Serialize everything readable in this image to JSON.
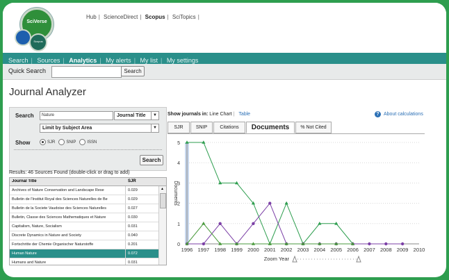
{
  "header": {
    "logo_main": "SciVerse",
    "logo_sub": "Scopus",
    "links": [
      "Hub",
      "ScienceDirect",
      "Scopus",
      "SciTopics"
    ],
    "active_link": "Scopus"
  },
  "nav": {
    "items": [
      "Search",
      "Sources",
      "Analytics",
      "My alerts",
      "My list",
      "My settings"
    ],
    "active": "Analytics"
  },
  "quick_search": {
    "label": "Quick Search",
    "value": "",
    "button": "Search"
  },
  "page_title": "Journal Analyzer",
  "search_panel": {
    "search_label": "Search",
    "search_value": "Nature",
    "search_type": "Journal Title",
    "filter": "Limit by Subject Area",
    "show_label": "Show",
    "metrics": [
      "SJR",
      "SNIP",
      "ISSN"
    ],
    "selected_metric": "SJR",
    "search_button": "Search"
  },
  "results": {
    "summary": "Results: 46 Sources Found (double-click or drag to add)",
    "columns": [
      "Journal Title",
      "SJR"
    ],
    "rows": [
      {
        "title": "Archives of Nature Conservation and Landscape Rese",
        "sjr": "0.029"
      },
      {
        "title": "Bulletin de l'Institut Royal des Sciences Naturelles de Be",
        "sjr": "0.029"
      },
      {
        "title": "Bulletin de la Societe Vaudoise des Sciences Naturelles",
        "sjr": "0.027"
      },
      {
        "title": "Bulletin, Classe des Sciences Mathematiques et Nature",
        "sjr": "0.030"
      },
      {
        "title": "Capitalism, Nature, Socialism",
        "sjr": "0.031"
      },
      {
        "title": "Discrete Dynamics in Nature and Society",
        "sjr": "0.040"
      },
      {
        "title": "Fortschritte der Chemie Organischer Naturstoffe",
        "sjr": "0.201"
      },
      {
        "title": "Human Nature",
        "sjr": "0.072"
      },
      {
        "title": "Humans and Nature",
        "sjr": "0.031"
      }
    ],
    "selected_row": 7
  },
  "chart_panel": {
    "show_journals_label": "Show journals in:",
    "view_line": "Line Chart",
    "view_table": "Table",
    "about": "About calculations",
    "tabs": [
      "SJR",
      "SNIP",
      "Citations",
      "Documents",
      "% Not Cited"
    ],
    "active_tab": "Documents"
  },
  "chart_data": {
    "type": "line",
    "ylabel": "Documents",
    "xlabel": "Zoom Year",
    "x": [
      1996,
      1997,
      1998,
      1999,
      2000,
      2001,
      2002,
      2003,
      2004,
      2005,
      2006,
      2007,
      2008,
      2009,
      2010
    ],
    "ylim": [
      0,
      5
    ],
    "yticks": [
      0,
      1,
      2,
      3,
      4,
      5
    ],
    "series": [
      {
        "color": "#2e9e4f",
        "marker": "triangle",
        "values": [
          5,
          5,
          3,
          3,
          2,
          0,
          2,
          0,
          1,
          1,
          0,
          null,
          null,
          null,
          null
        ]
      },
      {
        "color": "#7b3fa6",
        "marker": "circle",
        "values": [
          0,
          0,
          1,
          0,
          1,
          2,
          0,
          0,
          0,
          0,
          0,
          0,
          0,
          0,
          null
        ]
      },
      {
        "color": "#4a9a3c",
        "marker": "triangle",
        "values": [
          0,
          1,
          0,
          0,
          0,
          0,
          0,
          0,
          0,
          0,
          0,
          null,
          null,
          null,
          null
        ]
      }
    ]
  }
}
